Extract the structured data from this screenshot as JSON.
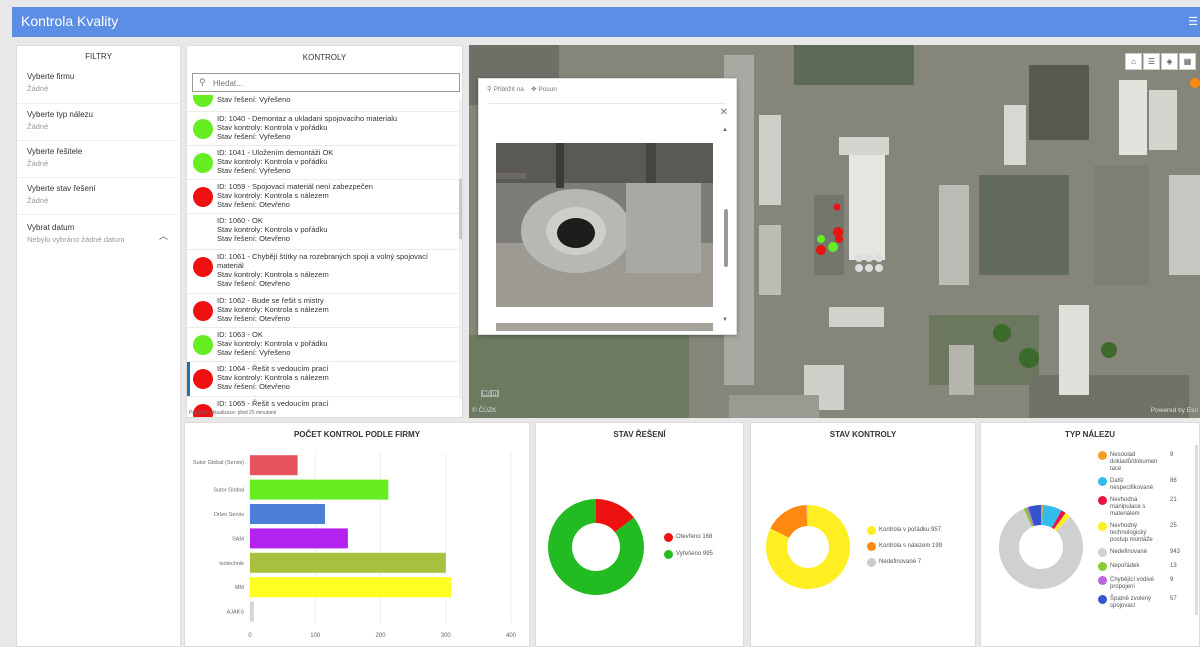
{
  "app": {
    "title": "Kontrola Kvality",
    "menu_icon": "menu-icon"
  },
  "filters": {
    "title": "FILTRY",
    "items": [
      {
        "label": "Vyberte firmu",
        "value": "Žádné"
      },
      {
        "label": "Vyberte typ nálezu",
        "value": "Žádné"
      },
      {
        "label": "Vyberte řešitele",
        "value": "Žádné"
      },
      {
        "label": "Vyberte stav řešení",
        "value": "Žádné"
      },
      {
        "label": "Vybrat datum",
        "value": "Nebylo vybráno žádné datum"
      }
    ]
  },
  "kontroly": {
    "title": "KONTROLY",
    "search_placeholder": "Hledat...",
    "updated": "Poslední aktualizace: před 25 minutami",
    "rows": [
      {
        "color": "#66ee22",
        "line1": "Stav řešení: Vyřešeno",
        "line2": "",
        "line3": ""
      },
      {
        "color": "#66ee22",
        "line1": "ID: 1040 - Demontaz a ukladani spojovaciho materialu",
        "line2": "Stav kontroly:  Kontrola v pořádku",
        "line3": "Stav řešení: Vyřešeno"
      },
      {
        "color": "#66ee22",
        "line1": "ID: 1041 - Uložením demontáži OK",
        "line2": "Stav kontroly:  Kontrola v pořádku",
        "line3": "Stav řešení: Vyřešeno"
      },
      {
        "color": "#ee1111",
        "line1": "ID: 1059 - Spojovací materiál není zabezpečen",
        "line2": "Stav kontroly:  Kontrola s nálezem",
        "line3": "Stav řešení: Otevřeno"
      },
      {
        "color": "",
        "line1": "ID: 1060 - OK",
        "line2": "Stav kontroly:  Kontrola v pořádku",
        "line3": "Stav řešení: Otevřeno"
      },
      {
        "color": "#ee1111",
        "line1": "ID: 1061 - Chybějí štítky na rozebraných spoji a volný spojovací materiál",
        "line2": "Stav kontroly:  Kontrola s nálezem",
        "line3": "Stav řešení: Otevřeno"
      },
      {
        "color": "#ee1111",
        "line1": "ID: 1062 - Bude se řešit s mistry",
        "line2": "Stav kontroly:  Kontrola s nálezem",
        "line3": "Stav řešení: Otevřeno"
      },
      {
        "color": "#66ee22",
        "line1": "ID: 1063 - OK",
        "line2": "Stav kontroly:  Kontrola v pořádku",
        "line3": "Stav řešení: Vyřešeno"
      },
      {
        "color": "#ee1111",
        "line1": "ID: 1064 - Řešit s vedoucím prací",
        "line2": "Stav kontroly:  Kontrola s nálezem",
        "line3": "Stav řešení: Otevřeno"
      },
      {
        "color": "#ee1111",
        "line1": "ID: 1065 - Řešit s vedoucím prací",
        "line2": "",
        "line3": ""
      }
    ]
  },
  "map": {
    "popup": {
      "zoom_label": "Přiblížit na",
      "pan_label": "Posun",
      "close_icon": "close-icon"
    },
    "scale": "60 m",
    "attribution": "© ČÚZK",
    "powered": "Powered by Esri"
  },
  "charts": {
    "bar_title": "POČET KONTROL PODLE FIRMY",
    "stav_reseni_title": "STAV ŘEŠENÍ",
    "stav_kontroly_title": "STAV KONTROLY",
    "typ_nalezu_title": "TYP NÁLEZU"
  },
  "chart_data": [
    {
      "type": "bar",
      "orientation": "horizontal",
      "title": "POČET KONTROL PODLE FIRMY",
      "categories": [
        "Sutor Global (Servis)",
        "Sutor Global",
        "Orlen Servis",
        "SAM",
        "Isotechnik",
        "MM",
        "AJAKS"
      ],
      "values": [
        73,
        212,
        115,
        150,
        300,
        308,
        6
      ],
      "colors": [
        "#e8545c",
        "#66ee22",
        "#4e7fd8",
        "#b322ee",
        "#a6c13e",
        "#ffff22",
        "#d6d6d6"
      ],
      "xlim": [
        0,
        400
      ],
      "xticks": [
        0,
        100,
        200,
        300,
        400
      ]
    },
    {
      "type": "pie",
      "donut": true,
      "title": "STAV ŘEŠENÍ",
      "labels": [
        "Otevřeno",
        "Vyřešeno"
      ],
      "values": [
        168,
        995
      ],
      "colors": [
        "#ee1111",
        "#22bb22"
      ]
    },
    {
      "type": "pie",
      "donut": true,
      "title": "STAV KONTROLY",
      "labels": [
        "Kontrola v pořádku",
        "Kontrola s nálezem",
        "Nedefinované"
      ],
      "values": [
        957,
        199,
        7
      ],
      "colors": [
        "#ffee22",
        "#ff8811",
        "#cccccc"
      ]
    },
    {
      "type": "pie",
      "donut": true,
      "title": "TYP NÁLEZU",
      "labels": [
        "Nesoulad dokladů/dokumentace",
        "Další nespecifikované",
        "Nevhodná manipulace s materiálem",
        "Nevhodný technologický postup montáže",
        "Nedefinované",
        "Nepořádek",
        "Chybějící vodivé propojení",
        "Špatně zvolený spojovací"
      ],
      "legend_lines": [
        [
          "Nesoulad",
          "dokladů/dokumen",
          "tace"
        ],
        [
          "Další",
          "nespecifikované"
        ],
        [
          "Nevhodná",
          "manipulace s",
          "materiálem"
        ],
        [
          "Nevhodný",
          "technologický",
          "postup montáže"
        ],
        [
          "Nedefinované"
        ],
        [
          "Nepořádek"
        ],
        [
          "Chybějící vodivé",
          "propojení"
        ],
        [
          "Špatně zvolený",
          "spojovací"
        ]
      ],
      "values": [
        9,
        86,
        21,
        25,
        943,
        13,
        9,
        57
      ],
      "colors": [
        "#f0a020",
        "#33bbee",
        "#ee1144",
        "#ffee22",
        "#d0d0d0",
        "#88cc33",
        "#bb66dd",
        "#3355cc"
      ]
    }
  ]
}
